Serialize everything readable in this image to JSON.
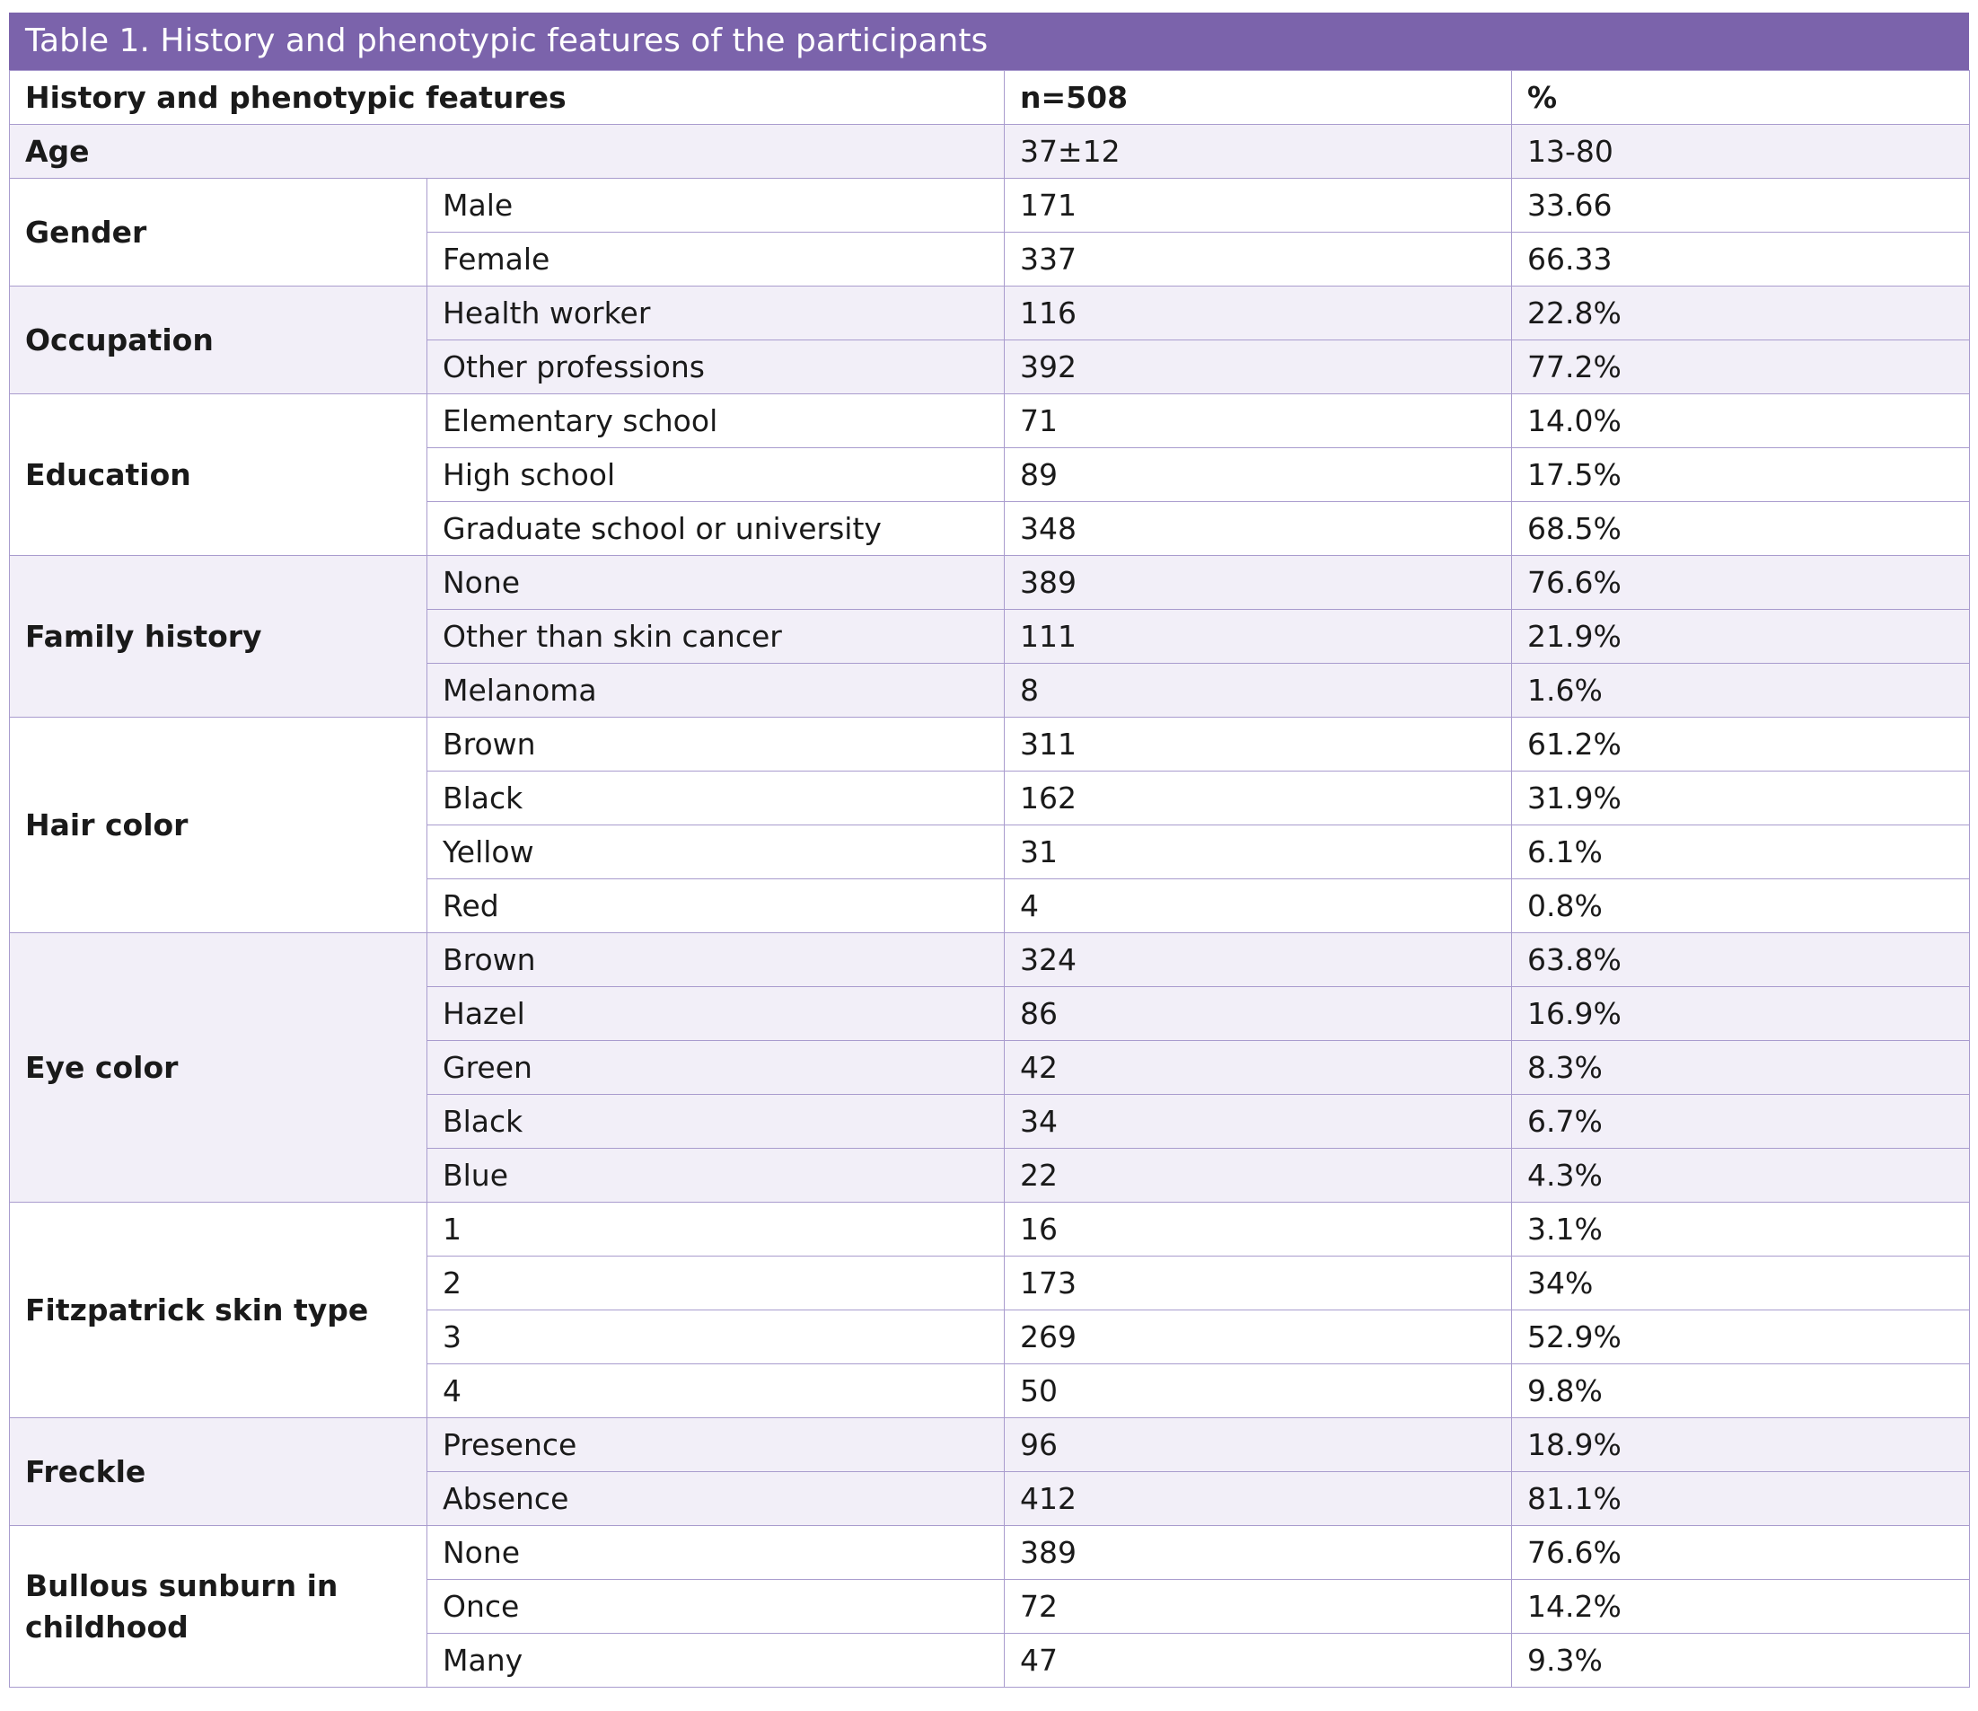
{
  "title": "Table 1. History and phenotypic features of the participants",
  "header": {
    "feature": "History and phenotypic features",
    "n": "n=508",
    "percent": "%"
  },
  "age": {
    "label": "Age",
    "n": "37±12",
    "percent": "13-80"
  },
  "groups": [
    {
      "label": "Gender",
      "rows": [
        {
          "category": "Male",
          "n": "171",
          "percent": "33.66"
        },
        {
          "category": "Female",
          "n": "337",
          "percent": "66.33"
        }
      ]
    },
    {
      "label": "Occupation",
      "rows": [
        {
          "category": "Health worker",
          "n": "116",
          "percent": "22.8%"
        },
        {
          "category": "Other professions",
          "n": "392",
          "percent": "77.2%"
        }
      ]
    },
    {
      "label": "Education",
      "rows": [
        {
          "category": "Elementary school",
          "n": "71",
          "percent": "14.0%"
        },
        {
          "category": "High school",
          "n": "89",
          "percent": "17.5%"
        },
        {
          "category": "Graduate school or university",
          "n": "348",
          "percent": "68.5%"
        }
      ]
    },
    {
      "label": "Family history",
      "rows": [
        {
          "category": "None",
          "n": "389",
          "percent": "76.6%"
        },
        {
          "category": "Other than skin cancer",
          "n": "111",
          "percent": "21.9%"
        },
        {
          "category": "Melanoma",
          "n": "8",
          "percent": "1.6%"
        }
      ]
    },
    {
      "label": "Hair color",
      "rows": [
        {
          "category": "Brown",
          "n": "311",
          "percent": "61.2%"
        },
        {
          "category": "Black",
          "n": "162",
          "percent": "31.9%"
        },
        {
          "category": "Yellow",
          "n": "31",
          "percent": "6.1%"
        },
        {
          "category": "Red",
          "n": "4",
          "percent": "0.8%"
        }
      ]
    },
    {
      "label": "Eye color",
      "rows": [
        {
          "category": "Brown",
          "n": "324",
          "percent": "63.8%"
        },
        {
          "category": "Hazel",
          "n": "86",
          "percent": "16.9%"
        },
        {
          "category": "Green",
          "n": "42",
          "percent": "8.3%"
        },
        {
          "category": "Black",
          "n": "34",
          "percent": "6.7%"
        },
        {
          "category": "Blue",
          "n": "22",
          "percent": "4.3%"
        }
      ]
    },
    {
      "label": "Fitzpatrick skin type",
      "rows": [
        {
          "category": "1",
          "n": "16",
          "percent": "3.1%"
        },
        {
          "category": "2",
          "n": "173",
          "percent": "34%"
        },
        {
          "category": "3",
          "n": "269",
          "percent": "52.9%"
        },
        {
          "category": "4",
          "n": "50",
          "percent": "9.8%"
        }
      ]
    },
    {
      "label": "Freckle",
      "rows": [
        {
          "category": "Presence",
          "n": "96",
          "percent": "18.9%"
        },
        {
          "category": "Absence",
          "n": "412",
          "percent": "81.1%"
        }
      ]
    },
    {
      "label": "Bullous sunburn in childhood",
      "rows": [
        {
          "category": "None",
          "n": "389",
          "percent": "76.6%"
        },
        {
          "category": "Once",
          "n": "72",
          "percent": "14.2%"
        },
        {
          "category": "Many",
          "n": "47",
          "percent": "9.3%"
        }
      ]
    }
  ],
  "colors": {
    "title_bg": "#7b63ab",
    "border": "#a99cce",
    "shade": "#f2eff8"
  }
}
